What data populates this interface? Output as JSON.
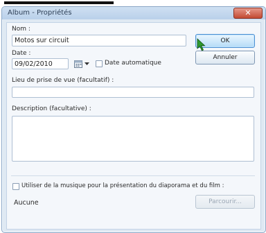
{
  "window": {
    "title": "Album - Propriétés",
    "close_symbol": "✕"
  },
  "form": {
    "name_label": "Nom :",
    "name_value": "Motos sur circuit",
    "date_label": "Date :",
    "date_value": "09/02/2010",
    "auto_date_label": "Date automatique",
    "auto_date_checked": false,
    "location_label": "Lieu de prise de vue (facultatif) :",
    "location_value": "",
    "description_label": "Description (facultative) :",
    "description_value": "",
    "music_label": "Utiliser de la musique pour la présentation du diaporama et du film :",
    "music_checked": false,
    "music_value": "Aucune"
  },
  "buttons": {
    "ok": "OK",
    "cancel": "Annuler",
    "browse": "Parcourir..."
  },
  "icons": {
    "calendar": "calendar-icon",
    "dropdown": "chevron-down-icon",
    "cursor": "mouse-cursor-icon"
  },
  "colors": {
    "accent": "#4c8fd2",
    "cursor": "#2f9a2f"
  }
}
